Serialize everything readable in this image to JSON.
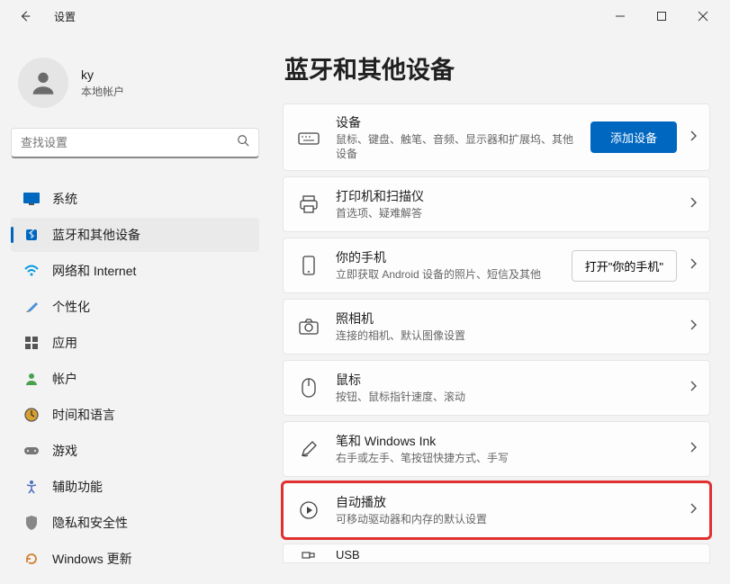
{
  "window": {
    "title": "设置"
  },
  "user": {
    "name": "ky",
    "account_type": "本地帐户"
  },
  "search": {
    "placeholder": "查找设置"
  },
  "sidebar": {
    "items": [
      {
        "label": "系统"
      },
      {
        "label": "蓝牙和其他设备"
      },
      {
        "label": "网络和 Internet"
      },
      {
        "label": "个性化"
      },
      {
        "label": "应用"
      },
      {
        "label": "帐户"
      },
      {
        "label": "时间和语言"
      },
      {
        "label": "游戏"
      },
      {
        "label": "辅助功能"
      },
      {
        "label": "隐私和安全性"
      },
      {
        "label": "Windows 更新"
      }
    ]
  },
  "page": {
    "title": "蓝牙和其他设备"
  },
  "cards": {
    "devices": {
      "title": "设备",
      "sub": "鼠标、键盘、触笔、音频、显示器和扩展坞、其他设备",
      "action": "添加设备"
    },
    "printers": {
      "title": "打印机和扫描仪",
      "sub": "首选项、疑难解答"
    },
    "phone": {
      "title": "你的手机",
      "sub": "立即获取 Android 设备的照片、短信及其他",
      "action": "打开\"你的手机\""
    },
    "camera": {
      "title": "照相机",
      "sub": "连接的相机、默认图像设置"
    },
    "mouse": {
      "title": "鼠标",
      "sub": "按钮、鼠标指针速度、滚动"
    },
    "pen": {
      "title": "笔和 Windows Ink",
      "sub": "右手或左手、笔按钮快捷方式、手写"
    },
    "autoplay": {
      "title": "自动播放",
      "sub": "可移动驱动器和内存的默认设置"
    },
    "usb": {
      "title": "USB"
    }
  }
}
